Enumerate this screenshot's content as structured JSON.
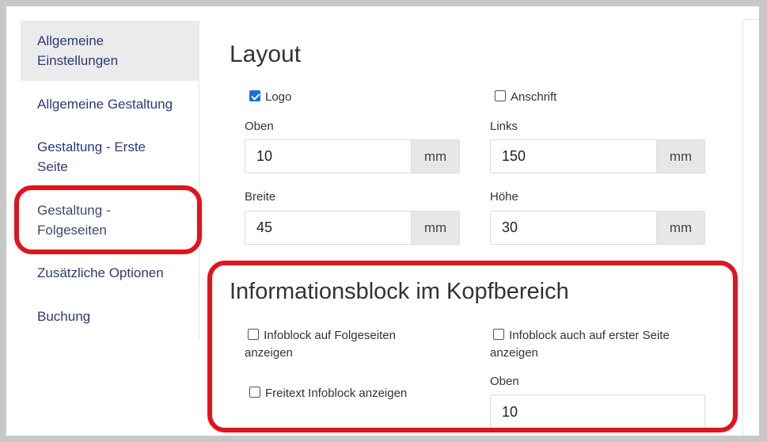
{
  "sidebar": {
    "items": [
      {
        "label_line1": "Allgemeine",
        "label_line2": "Einstellungen"
      },
      {
        "label": "Allgemeine Gestaltung"
      },
      {
        "label_line1": "Gestaltung - Erste",
        "label_line2": "Seite"
      },
      {
        "label_line1": "Gestaltung -",
        "label_line2": "Folgeseiten"
      },
      {
        "label": "Zusätzliche Optionen"
      },
      {
        "label": "Buchung"
      }
    ]
  },
  "layout": {
    "title": "Layout",
    "logo_checkbox": {
      "label": "Logo",
      "checked": true
    },
    "anschrift_checkbox": {
      "label": "Anschrift",
      "checked": false
    },
    "oben": {
      "label": "Oben",
      "value": "10",
      "unit": "mm"
    },
    "links": {
      "label": "Links",
      "value": "150",
      "unit": "mm"
    },
    "breite": {
      "label": "Breite",
      "value": "45",
      "unit": "mm"
    },
    "hoehe": {
      "label": "Höhe",
      "value": "30",
      "unit": "mm"
    }
  },
  "infoblock": {
    "title": "Informationsblock im Kopfbereich",
    "folgeseiten_checkbox": {
      "line1": "Infoblock auf Folgeseiten",
      "line2": "anzeigen",
      "checked": false
    },
    "erste_seite_checkbox": {
      "line1": "Infoblock auch auf erster Seite",
      "line2": "anzeigen",
      "checked": false
    },
    "freitext_checkbox": {
      "label": "Freitext Infoblock anzeigen",
      "checked": false
    },
    "oben": {
      "label": "Oben",
      "value": "10"
    }
  },
  "colors": {
    "highlight": "#e0141e",
    "link": "#2b3a7a",
    "checkbox_checked": "#1a6fd6"
  }
}
